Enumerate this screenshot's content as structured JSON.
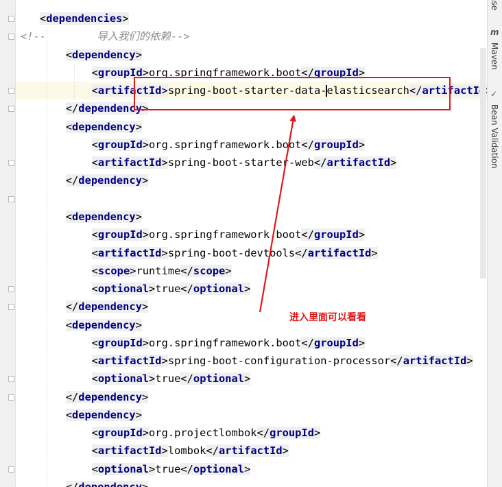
{
  "editor": {
    "lines": [
      {
        "indent": 1,
        "parts": [
          {
            "k": "br",
            "t": "<"
          },
          {
            "k": "tag",
            "t": "dependencies"
          },
          {
            "k": "br",
            "t": ">"
          }
        ]
      },
      {
        "indent": 0,
        "parts": [
          {
            "k": "cmt",
            "t": "<!--        "
          },
          {
            "k": "cmt cjk",
            "t": "导入我们的依赖"
          },
          {
            "k": "cmt",
            "t": "-->"
          }
        ]
      },
      {
        "indent": 2,
        "parts": [
          {
            "k": "br",
            "t": "<"
          },
          {
            "k": "tag",
            "t": "dependency"
          },
          {
            "k": "br",
            "t": ">"
          }
        ]
      },
      {
        "indent": 3,
        "parts": [
          {
            "k": "br",
            "t": "<"
          },
          {
            "k": "tag",
            "t": "groupId"
          },
          {
            "k": "br",
            "t": ">"
          },
          {
            "k": "txt",
            "t": "org.springframework.boot"
          },
          {
            "k": "br",
            "t": "</"
          },
          {
            "k": "tag",
            "t": "groupId"
          },
          {
            "k": "br",
            "t": ">"
          }
        ]
      },
      {
        "indent": 3,
        "caret_after": 4,
        "parts": [
          {
            "k": "br",
            "t": "<"
          },
          {
            "k": "tag",
            "t": "artifactId"
          },
          {
            "k": "br",
            "t": ">"
          },
          {
            "k": "txt",
            "t": "spring-boot-starter-data-"
          },
          {
            "k": "txt",
            "t": "elasticsearch"
          },
          {
            "k": "br",
            "t": "</"
          },
          {
            "k": "tag",
            "t": "artifactId"
          },
          {
            "k": "br",
            "t": ">"
          }
        ]
      },
      {
        "indent": 2,
        "parts": [
          {
            "k": "br",
            "t": "</"
          },
          {
            "k": "tag",
            "t": "dependency"
          },
          {
            "k": "br",
            "t": ">"
          }
        ]
      },
      {
        "indent": 2,
        "parts": [
          {
            "k": "br",
            "t": "<"
          },
          {
            "k": "tag",
            "t": "dependency"
          },
          {
            "k": "br",
            "t": ">"
          }
        ]
      },
      {
        "indent": 3,
        "parts": [
          {
            "k": "br",
            "t": "<"
          },
          {
            "k": "tag",
            "t": "groupId"
          },
          {
            "k": "br",
            "t": ">"
          },
          {
            "k": "txt",
            "t": "org.springframework.boot"
          },
          {
            "k": "br",
            "t": "</"
          },
          {
            "k": "tag",
            "t": "groupId"
          },
          {
            "k": "br",
            "t": ">"
          }
        ]
      },
      {
        "indent": 3,
        "parts": [
          {
            "k": "br",
            "t": "<"
          },
          {
            "k": "tag",
            "t": "artifactId"
          },
          {
            "k": "br",
            "t": ">"
          },
          {
            "k": "txt",
            "t": "spring-boot-starter-web"
          },
          {
            "k": "br",
            "t": "</"
          },
          {
            "k": "tag",
            "t": "artifactId"
          },
          {
            "k": "br",
            "t": ">"
          }
        ]
      },
      {
        "indent": 2,
        "parts": [
          {
            "k": "br",
            "t": "</"
          },
          {
            "k": "tag",
            "t": "dependency"
          },
          {
            "k": "br",
            "t": ">"
          }
        ]
      },
      {
        "indent": 0,
        "parts": []
      },
      {
        "indent": 2,
        "parts": [
          {
            "k": "br",
            "t": "<"
          },
          {
            "k": "tag",
            "t": "dependency"
          },
          {
            "k": "br",
            "t": ">"
          }
        ]
      },
      {
        "indent": 3,
        "parts": [
          {
            "k": "br",
            "t": "<"
          },
          {
            "k": "tag",
            "t": "groupId"
          },
          {
            "k": "br",
            "t": ">"
          },
          {
            "k": "txt",
            "t": "org.springframework.boot"
          },
          {
            "k": "br",
            "t": "</"
          },
          {
            "k": "tag",
            "t": "groupId"
          },
          {
            "k": "br",
            "t": ">"
          }
        ]
      },
      {
        "indent": 3,
        "parts": [
          {
            "k": "br",
            "t": "<"
          },
          {
            "k": "tag",
            "t": "artifactId"
          },
          {
            "k": "br",
            "t": ">"
          },
          {
            "k": "txt",
            "t": "spring-boot-devtools"
          },
          {
            "k": "br",
            "t": "</"
          },
          {
            "k": "tag",
            "t": "artifactId"
          },
          {
            "k": "br",
            "t": ">"
          }
        ]
      },
      {
        "indent": 3,
        "parts": [
          {
            "k": "br",
            "t": "<"
          },
          {
            "k": "tag",
            "t": "scope"
          },
          {
            "k": "br",
            "t": ">"
          },
          {
            "k": "txt",
            "t": "runtime"
          },
          {
            "k": "br",
            "t": "</"
          },
          {
            "k": "tag",
            "t": "scope"
          },
          {
            "k": "br",
            "t": ">"
          }
        ]
      },
      {
        "indent": 3,
        "parts": [
          {
            "k": "br",
            "t": "<"
          },
          {
            "k": "tag",
            "t": "optional"
          },
          {
            "k": "br",
            "t": ">"
          },
          {
            "k": "txt",
            "t": "true"
          },
          {
            "k": "br",
            "t": "</"
          },
          {
            "k": "tag",
            "t": "optional"
          },
          {
            "k": "br",
            "t": ">"
          }
        ]
      },
      {
        "indent": 2,
        "parts": [
          {
            "k": "br",
            "t": "</"
          },
          {
            "k": "tag",
            "t": "dependency"
          },
          {
            "k": "br",
            "t": ">"
          }
        ]
      },
      {
        "indent": 2,
        "parts": [
          {
            "k": "br",
            "t": "<"
          },
          {
            "k": "tag",
            "t": "dependency"
          },
          {
            "k": "br",
            "t": ">"
          }
        ]
      },
      {
        "indent": 3,
        "parts": [
          {
            "k": "br",
            "t": "<"
          },
          {
            "k": "tag",
            "t": "groupId"
          },
          {
            "k": "br",
            "t": ">"
          },
          {
            "k": "txt",
            "t": "org.springframework.boot"
          },
          {
            "k": "br",
            "t": "</"
          },
          {
            "k": "tag",
            "t": "groupId"
          },
          {
            "k": "br",
            "t": ">"
          }
        ]
      },
      {
        "indent": 3,
        "parts": [
          {
            "k": "br",
            "t": "<"
          },
          {
            "k": "tag",
            "t": "artifactId"
          },
          {
            "k": "br",
            "t": ">"
          },
          {
            "k": "txt",
            "t": "spring-boot-configuration-processor"
          },
          {
            "k": "br",
            "t": "</"
          },
          {
            "k": "tag",
            "t": "artifactId"
          },
          {
            "k": "br",
            "t": ">"
          }
        ]
      },
      {
        "indent": 3,
        "parts": [
          {
            "k": "br",
            "t": "<"
          },
          {
            "k": "tag",
            "t": "optional"
          },
          {
            "k": "br",
            "t": ">"
          },
          {
            "k": "txt",
            "t": "true"
          },
          {
            "k": "br",
            "t": "</"
          },
          {
            "k": "tag",
            "t": "optional"
          },
          {
            "k": "br",
            "t": ">"
          }
        ]
      },
      {
        "indent": 2,
        "parts": [
          {
            "k": "br",
            "t": "</"
          },
          {
            "k": "tag",
            "t": "dependency"
          },
          {
            "k": "br",
            "t": ">"
          }
        ]
      },
      {
        "indent": 2,
        "parts": [
          {
            "k": "br",
            "t": "<"
          },
          {
            "k": "tag",
            "t": "dependency"
          },
          {
            "k": "br",
            "t": ">"
          }
        ]
      },
      {
        "indent": 3,
        "parts": [
          {
            "k": "br",
            "t": "<"
          },
          {
            "k": "tag",
            "t": "groupId"
          },
          {
            "k": "br",
            "t": ">"
          },
          {
            "k": "txt",
            "t": "org.projectlombok"
          },
          {
            "k": "br",
            "t": "</"
          },
          {
            "k": "tag",
            "t": "groupId"
          },
          {
            "k": "br",
            "t": ">"
          }
        ]
      },
      {
        "indent": 3,
        "parts": [
          {
            "k": "br",
            "t": "<"
          },
          {
            "k": "tag",
            "t": "artifactId"
          },
          {
            "k": "br",
            "t": ">"
          },
          {
            "k": "txt",
            "t": "lombok"
          },
          {
            "k": "br",
            "t": "</"
          },
          {
            "k": "tag",
            "t": "artifactId"
          },
          {
            "k": "br",
            "t": ">"
          }
        ]
      },
      {
        "indent": 3,
        "parts": [
          {
            "k": "br",
            "t": "<"
          },
          {
            "k": "tag",
            "t": "optional"
          },
          {
            "k": "br",
            "t": ">"
          },
          {
            "k": "txt",
            "t": "true"
          },
          {
            "k": "br",
            "t": "</"
          },
          {
            "k": "tag",
            "t": "optional"
          },
          {
            "k": "br",
            "t": ">"
          }
        ]
      },
      {
        "indent": 2,
        "parts": [
          {
            "k": "br",
            "t": "</"
          },
          {
            "k": "tag",
            "t": "dependency"
          },
          {
            "k": "br",
            "t": ">"
          }
        ]
      }
    ],
    "fold_markers": [
      {
        "line": 1,
        "kind": "start"
      },
      {
        "line": 2,
        "kind": "start"
      },
      {
        "line": 5,
        "kind": "end"
      },
      {
        "line": 6,
        "kind": "start"
      },
      {
        "line": 9,
        "kind": "end"
      },
      {
        "line": 11,
        "kind": "start"
      },
      {
        "line": 16,
        "kind": "end"
      },
      {
        "line": 17,
        "kind": "start"
      },
      {
        "line": 21,
        "kind": "end"
      },
      {
        "line": 22,
        "kind": "start"
      },
      {
        "line": 26,
        "kind": "end"
      }
    ]
  },
  "side_panel": {
    "tabs": [
      {
        "label": "ase",
        "icon": "database-tool-window-icon"
      },
      {
        "label": "Maven",
        "icon": "maven-tool-window-icon",
        "icon_glyph": "m"
      },
      {
        "label": "Bean Validation",
        "icon": "bean-validation-tool-window-icon",
        "icon_glyph": "✓"
      }
    ]
  },
  "annotation": {
    "callout_text": "进入里面可以看看",
    "color": "#e01818"
  }
}
